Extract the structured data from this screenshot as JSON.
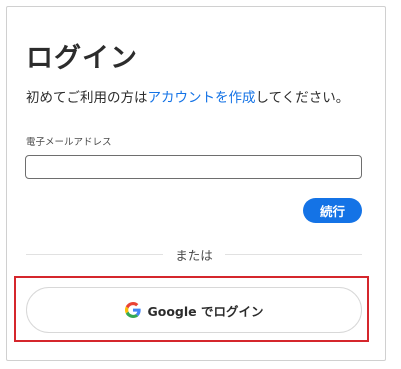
{
  "login": {
    "title": "ログイン",
    "subtitle_prefix": "初めてご利用の方は",
    "subtitle_link": "アカウントを作成",
    "subtitle_suffix": "してください。",
    "email_label": "電子メールアドレス",
    "email_value": "",
    "continue_label": "続行",
    "or_text": "または",
    "google_button_label": "Google でログイン",
    "google_icon": "google-g-icon"
  },
  "colors": {
    "accent": "#1473e6",
    "highlight": "#d5262c",
    "text": "#2c2c2c"
  }
}
